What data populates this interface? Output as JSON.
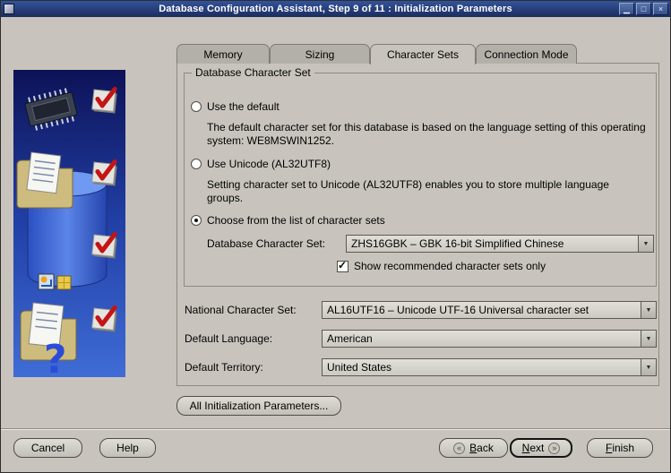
{
  "window": {
    "title": "Database Configuration Assistant, Step 9 of 11 : Initialization Parameters"
  },
  "icons": {
    "minimize": "▁",
    "maximize": "□",
    "close": "×",
    "back_chevrons": "«",
    "next_chevrons": "»",
    "dropdown_arrow": "▼",
    "checkmark": "✓"
  },
  "tabs": [
    {
      "label": "Memory",
      "active": false
    },
    {
      "label": "Sizing",
      "active": false
    },
    {
      "label": "Character Sets",
      "active": true
    },
    {
      "label": "Connection Mode",
      "active": false
    }
  ],
  "charset_group": {
    "title": "Database Character Set",
    "option_default": {
      "label": "Use the default",
      "selected": false,
      "description": "The default character set for this database is based on the language setting of this operating system: WE8MSWIN1252."
    },
    "option_unicode": {
      "label": "Use Unicode (AL32UTF8)",
      "selected": false,
      "description": "Setting character set to Unicode (AL32UTF8) enables you to store multiple language groups."
    },
    "option_choose": {
      "label": "Choose from the list of character sets",
      "selected": true
    },
    "db_charset": {
      "label": "Database Character Set:",
      "value": "ZHS16GBK – GBK 16-bit Simplified Chinese"
    },
    "show_recommended": {
      "label": "Show recommended character sets only",
      "checked": true
    }
  },
  "fields": {
    "national_charset": {
      "label": "National Character Set:",
      "value": "AL16UTF16 – Unicode UTF-16 Universal character set"
    },
    "default_language": {
      "label": "Default Language:",
      "value": "American"
    },
    "default_territory": {
      "label": "Default Territory:",
      "value": "United States"
    }
  },
  "all_init_params_label": "All Initialization Parameters...",
  "footer": {
    "cancel": "Cancel",
    "help": "Help",
    "back": "Back",
    "next": "Next",
    "finish": "Finish"
  }
}
